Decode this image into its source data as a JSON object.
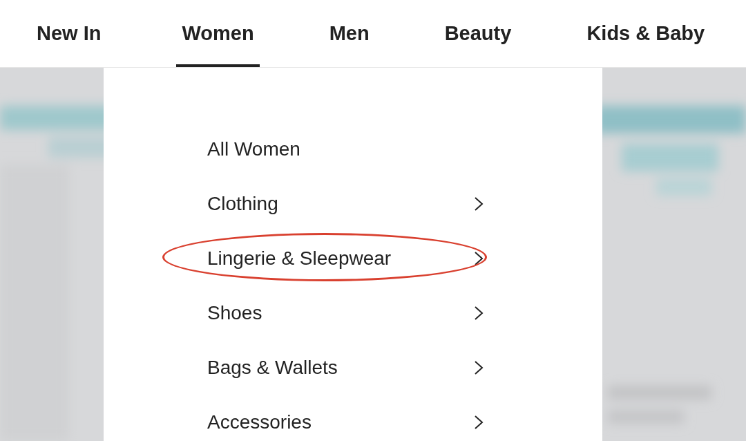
{
  "nav": [
    {
      "label": "New In",
      "selected": false
    },
    {
      "label": "Women",
      "selected": true
    },
    {
      "label": "Men",
      "selected": false
    },
    {
      "label": "Beauty",
      "selected": false
    },
    {
      "label": "Kids & Baby",
      "selected": false
    }
  ],
  "menu": {
    "items": [
      {
        "label": "All Women",
        "has_submenu": false,
        "circled": false
      },
      {
        "label": "Clothing",
        "has_submenu": true,
        "circled": false
      },
      {
        "label": "Lingerie & Sleepwear",
        "has_submenu": true,
        "circled": true
      },
      {
        "label": "Shoes",
        "has_submenu": true,
        "circled": false
      },
      {
        "label": "Bags & Wallets",
        "has_submenu": true,
        "circled": false
      },
      {
        "label": "Accessories",
        "has_submenu": true,
        "circled": false
      }
    ]
  }
}
